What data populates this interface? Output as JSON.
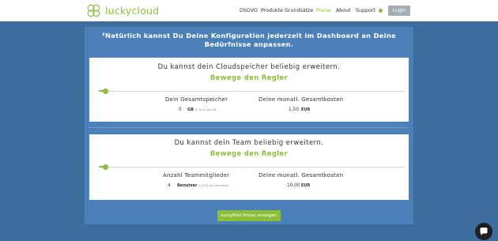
{
  "header": {
    "brand": "luckycloud",
    "nav": [
      "DSGVO",
      "Produkte",
      "Grundsätze",
      "Preise",
      "About",
      "Support"
    ],
    "active_item": "Preise",
    "login_label": "Login"
  },
  "panel": {
    "note": "²Natürlich kannst Du Deine Konfiguration jederzeit im Dashboard an Deine Bedürfnisse anpassen."
  },
  "storage_card": {
    "title": "Du kannst dein Cloudspeicher beliebig erweitern.",
    "slider_hint": "Bewege den Regler",
    "slider_fraction": 0.02,
    "col1_head": "Dein Gesamtspeicher",
    "col2_head": "Deine monatl. Gesamtkosten",
    "amount": "5",
    "unit": "GB",
    "unit_extra": "0,30 € pro GB",
    "price": "1,50",
    "currency": "EUR"
  },
  "team_card": {
    "title": "Du kannst dein Team beliebig erweitern.",
    "slider_hint": "Bewege den Regler",
    "slider_fraction": 0.02,
    "col1_head": "Anzahl Teammitglieder",
    "col2_head": "Deine monatl. Gesamtkosten",
    "amount": "4",
    "unit": "Benutzer",
    "unit_extra": "2,50 € pro Benutzer",
    "price": "10,00",
    "currency": "EUR"
  },
  "cta_label": "luckyMail Preise anzeigen",
  "colors": {
    "brand_green": "#8bbf3a",
    "page_blue": "#3d6d9d",
    "panel_blue": "#4b81b8"
  },
  "icons": [
    "luckycloud-logo-icon",
    "status-dot-icon",
    "chat-bubble-icon"
  ]
}
